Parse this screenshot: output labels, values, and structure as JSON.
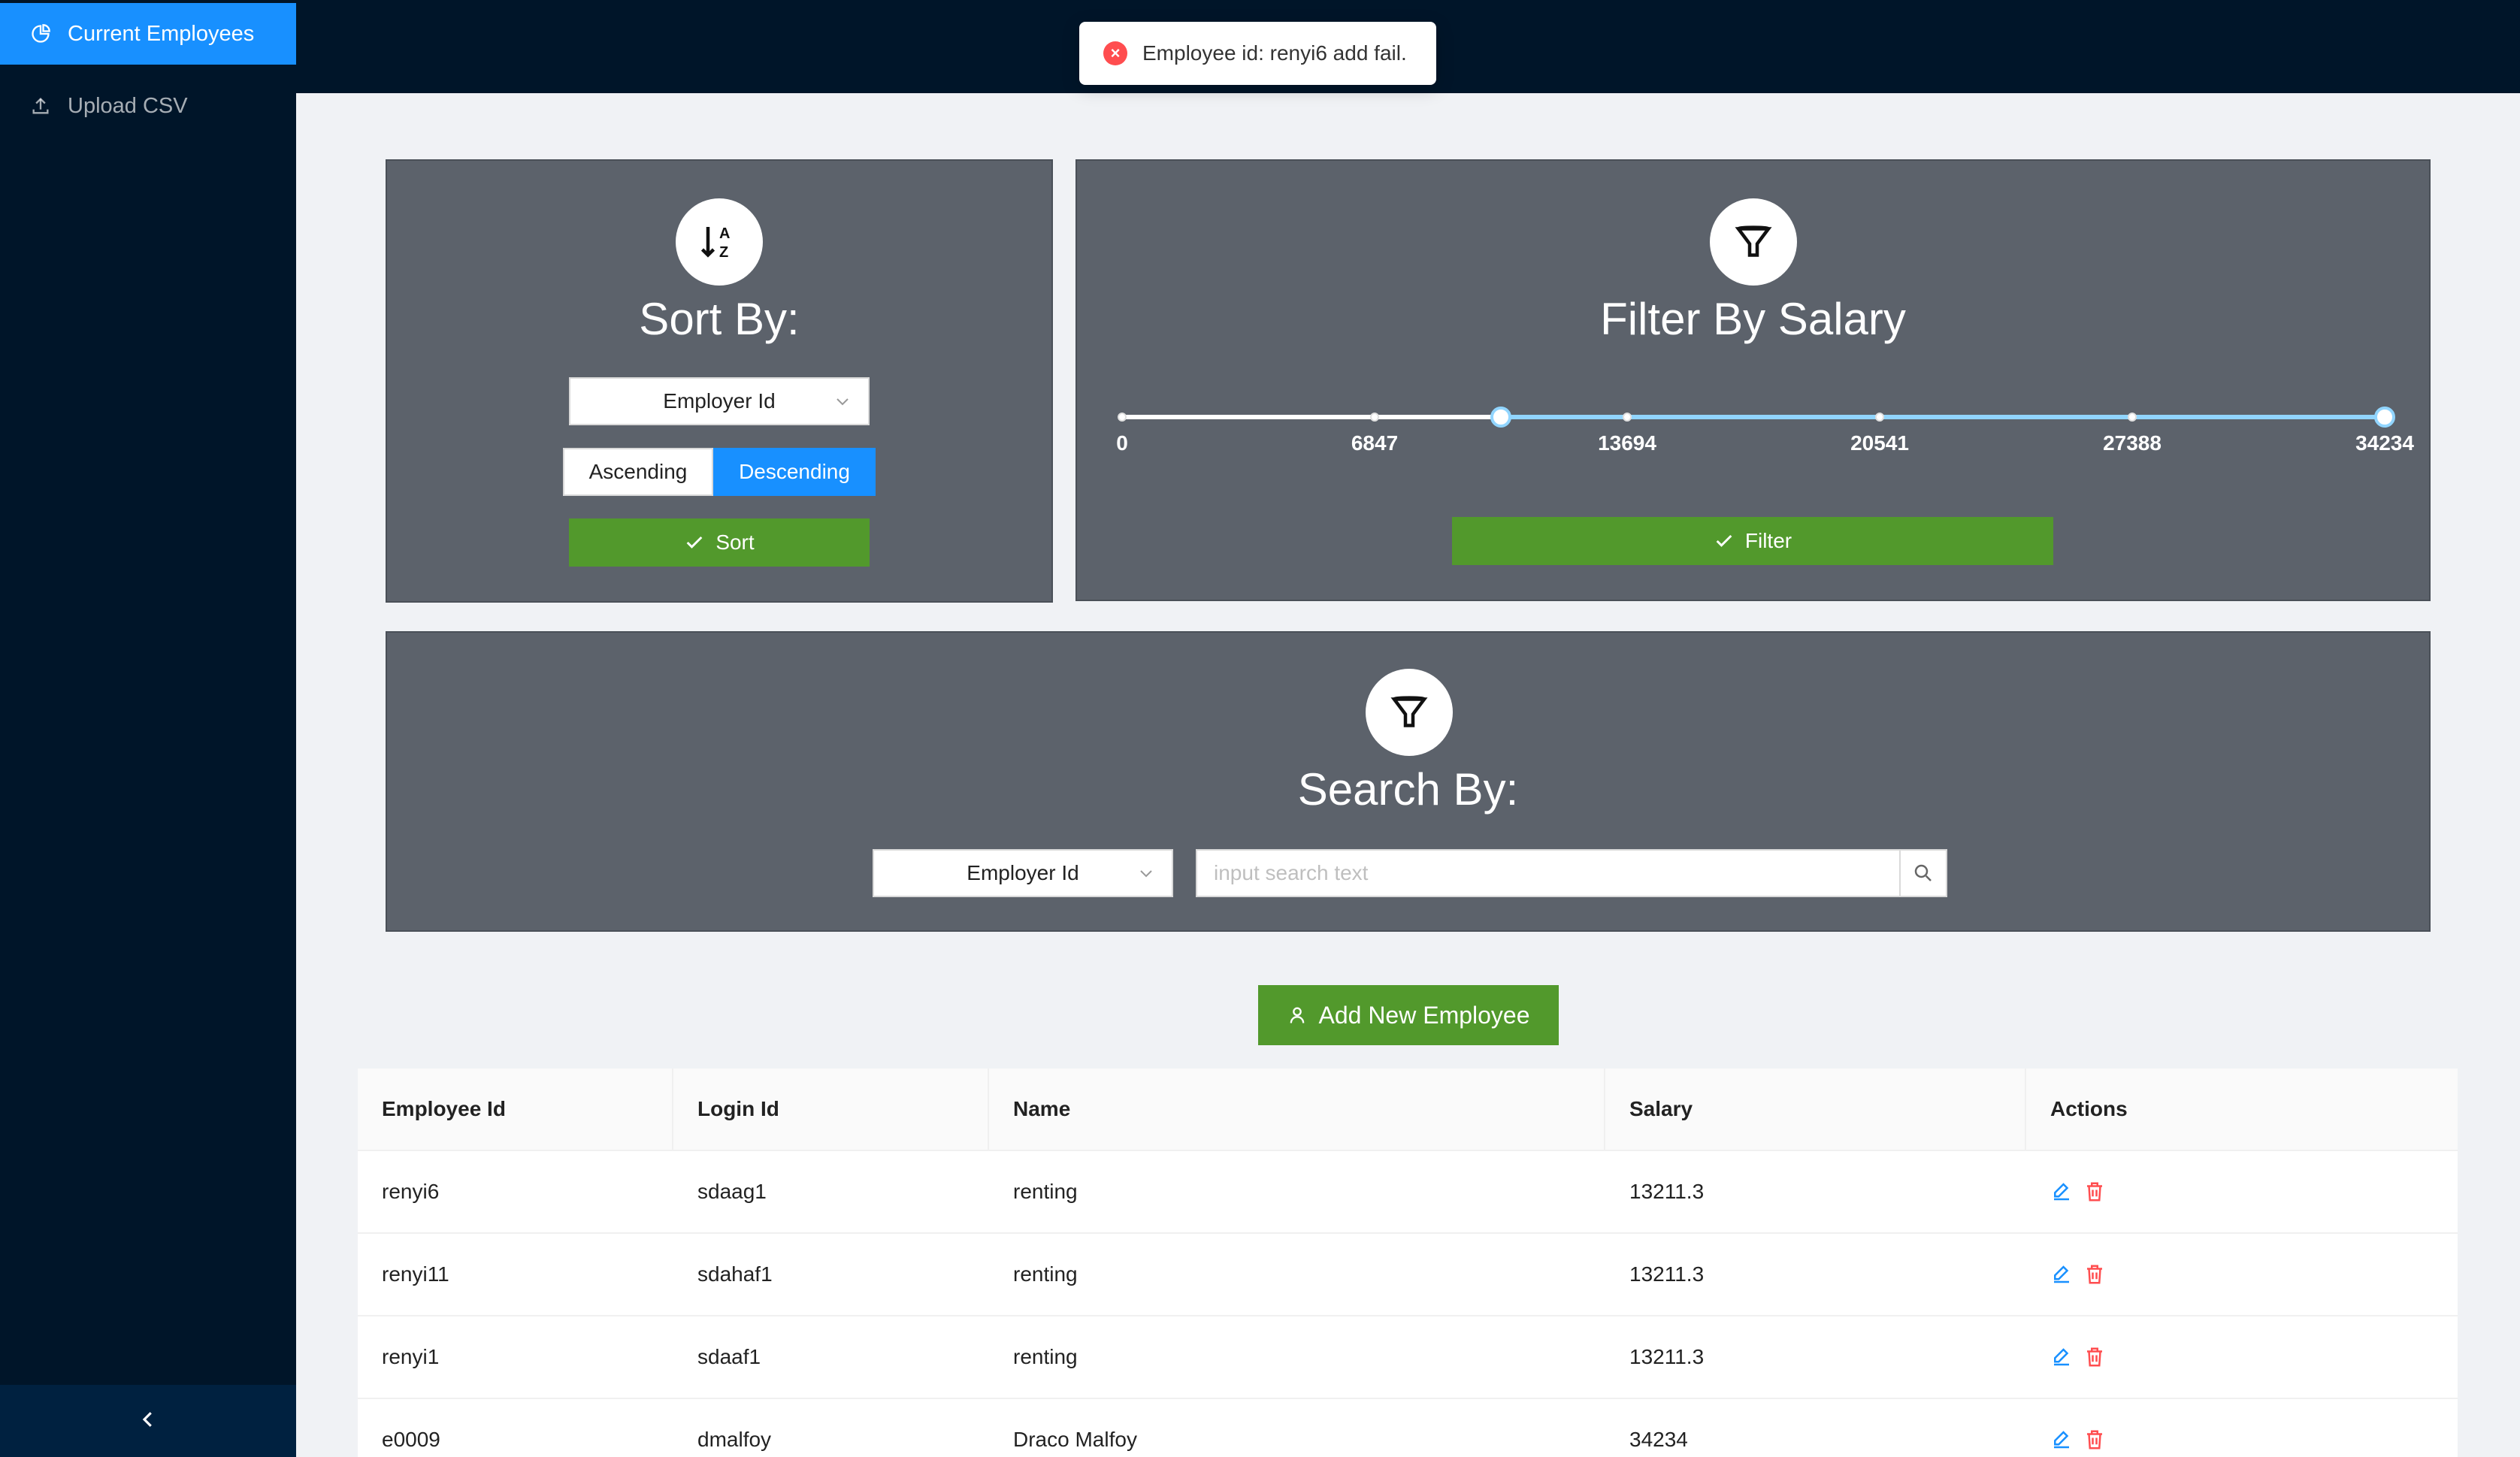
{
  "sidebar": {
    "items": [
      {
        "label": "Current Employees",
        "icon": "pie-chart-icon",
        "selected": true
      },
      {
        "label": "Upload CSV",
        "icon": "upload-icon",
        "selected": false
      }
    ],
    "collapse_icon": "chevron-left-icon"
  },
  "toast": {
    "message": "Employee id: renyi6 add fail.",
    "icon": "error-circle-icon",
    "color": "#ff4d4f"
  },
  "sort": {
    "title": "Sort By:",
    "icon": "sort-az-icon",
    "field": "Employer Id",
    "ascending_label": "Ascending",
    "descending_label": "Descending",
    "active_order": "Descending",
    "button_label": "Sort"
  },
  "filter": {
    "title": "Filter By Salary",
    "icon": "funnel-icon",
    "marks": [
      "0",
      "6847",
      "13694",
      "20541",
      "27388",
      "34234"
    ],
    "range_min": 0,
    "range_max": 34234,
    "selected_low": 10270,
    "selected_high": 34234,
    "button_label": "Filter"
  },
  "search": {
    "title": "Search By:",
    "icon": "funnel-icon",
    "field": "Employer Id",
    "placeholder": "input search text"
  },
  "add_button_label": "Add New Employee",
  "table": {
    "headers": {
      "id": "Employee Id",
      "login": "Login Id",
      "name": "Name",
      "salary": "Salary",
      "actions": "Actions"
    },
    "rows": [
      {
        "id": "renyi6",
        "login": "sdaag1",
        "name": "renting",
        "salary": "13211.3"
      },
      {
        "id": "renyi11",
        "login": "sdahaf1",
        "name": "renting",
        "salary": "13211.3"
      },
      {
        "id": "renyi1",
        "login": "sdaaf1",
        "name": "renting",
        "salary": "13211.3"
      },
      {
        "id": "e0009",
        "login": "dmalfoy",
        "name": "Draco Malfoy",
        "salary": "34234"
      }
    ]
  },
  "colors": {
    "primary": "#1890ff",
    "success": "#52992c",
    "danger": "#ff4d4f",
    "panel": "#5c626b",
    "sider": "#001529"
  }
}
